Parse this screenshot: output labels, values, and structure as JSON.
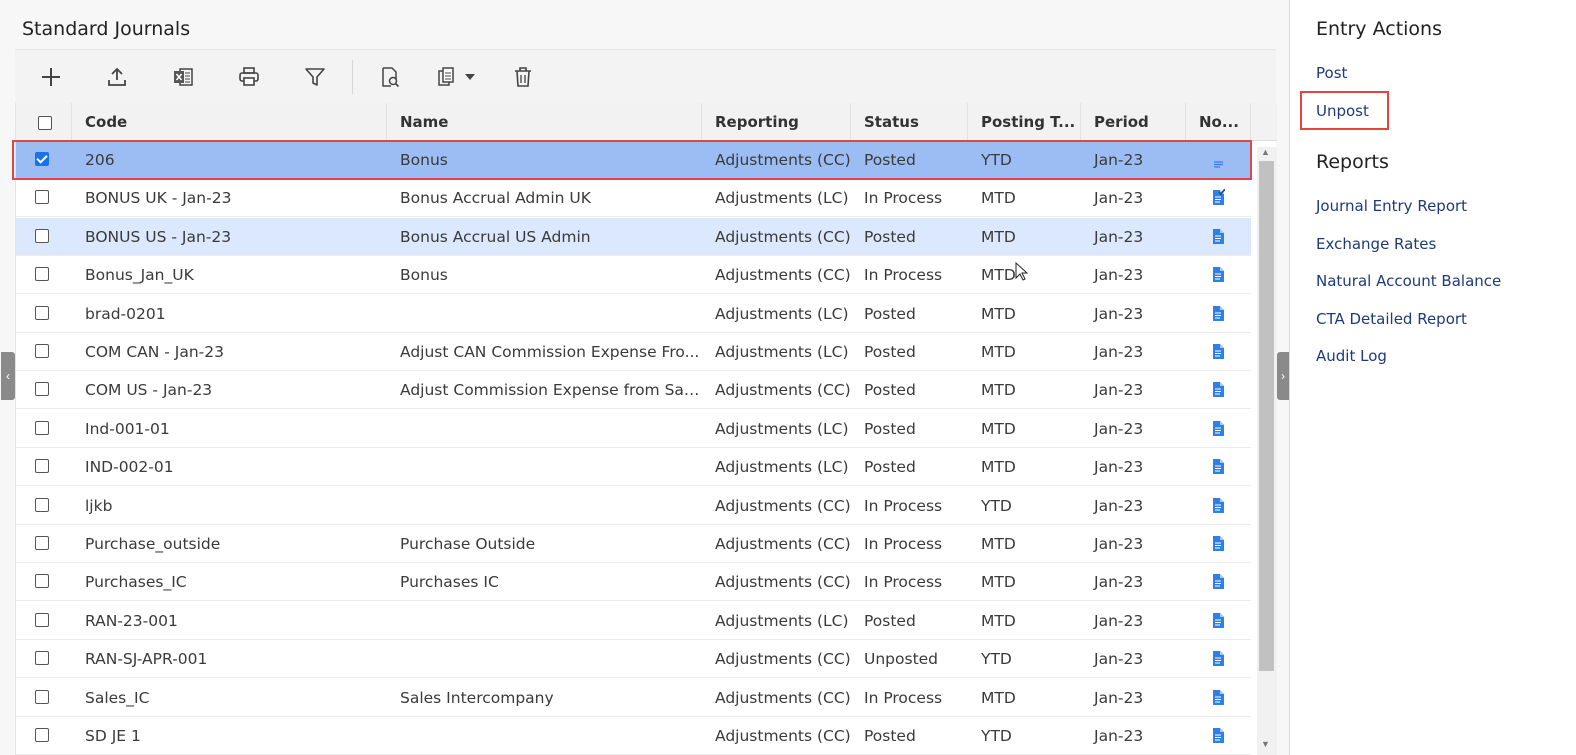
{
  "page": {
    "title": "Standard Journals"
  },
  "toolbar": {
    "buttons": [
      {
        "icon": "plus-icon"
      },
      {
        "icon": "upload-icon"
      },
      {
        "icon": "excel-icon"
      },
      {
        "icon": "print-icon"
      },
      {
        "icon": "filter-icon"
      },
      {
        "icon": "view-document-icon"
      },
      {
        "icon": "copy-dropdown-icon"
      },
      {
        "icon": "trash-icon"
      }
    ]
  },
  "grid": {
    "columns": [
      "Code",
      "Name",
      "Reporting",
      "Status",
      "Posting T...",
      "Period",
      "No..."
    ],
    "rows": [
      {
        "code": "206",
        "name": "Bonus",
        "reporting": "Adjustments (CC)",
        "status": "Posted",
        "posting_type": "YTD",
        "period": "Jan-23",
        "checked": true,
        "note": "lines"
      },
      {
        "code": "BONUS UK - Jan-23",
        "name": "Bonus Accrual Admin UK",
        "reporting": "Adjustments (LC)",
        "status": "In Process",
        "posting_type": "MTD",
        "period": "Jan-23",
        "checked": false,
        "note": "doc-check"
      },
      {
        "code": "BONUS US - Jan-23",
        "name": "Bonus Accrual US Admin",
        "reporting": "Adjustments (CC)",
        "status": "Posted",
        "posting_type": "MTD",
        "period": "Jan-23",
        "checked": false,
        "note": "doc"
      },
      {
        "code": "Bonus_Jan_UK",
        "name": "Bonus",
        "reporting": "Adjustments (CC)",
        "status": "In Process",
        "posting_type": "MTD",
        "period": "Jan-23",
        "checked": false,
        "note": "doc"
      },
      {
        "code": "brad-0201",
        "name": "",
        "reporting": "Adjustments (LC)",
        "status": "Posted",
        "posting_type": "MTD",
        "period": "Jan-23",
        "checked": false,
        "note": "doc"
      },
      {
        "code": "COM CAN - Jan-23",
        "name": "Adjust CAN Commission Expense Fro...",
        "reporting": "Adjustments (LC)",
        "status": "Posted",
        "posting_type": "MTD",
        "period": "Jan-23",
        "checked": false,
        "note": "doc"
      },
      {
        "code": "COM US - Jan-23",
        "name": "Adjust Commission Expense from Sale...",
        "reporting": "Adjustments (CC)",
        "status": "Posted",
        "posting_type": "MTD",
        "period": "Jan-23",
        "checked": false,
        "note": "doc"
      },
      {
        "code": "Ind-001-01",
        "name": "",
        "reporting": "Adjustments (LC)",
        "status": "Posted",
        "posting_type": "MTD",
        "period": "Jan-23",
        "checked": false,
        "note": "doc"
      },
      {
        "code": "IND-002-01",
        "name": "",
        "reporting": "Adjustments (LC)",
        "status": "Posted",
        "posting_type": "MTD",
        "period": "Jan-23",
        "checked": false,
        "note": "doc"
      },
      {
        "code": "ljkb",
        "name": "",
        "reporting": "Adjustments (CC)",
        "status": "In Process",
        "posting_type": "YTD",
        "period": "Jan-23",
        "checked": false,
        "note": "doc"
      },
      {
        "code": "Purchase_outside",
        "name": "Purchase Outside",
        "reporting": "Adjustments (CC)",
        "status": "In Process",
        "posting_type": "MTD",
        "period": "Jan-23",
        "checked": false,
        "note": "doc"
      },
      {
        "code": "Purchases_IC",
        "name": "Purchases IC",
        "reporting": "Adjustments (CC)",
        "status": "In Process",
        "posting_type": "MTD",
        "period": "Jan-23",
        "checked": false,
        "note": "doc"
      },
      {
        "code": "RAN-23-001",
        "name": "",
        "reporting": "Adjustments (LC)",
        "status": "Posted",
        "posting_type": "MTD",
        "period": "Jan-23",
        "checked": false,
        "note": "doc"
      },
      {
        "code": "RAN-SJ-APR-001",
        "name": "",
        "reporting": "Adjustments (CC)",
        "status": "Unposted",
        "posting_type": "YTD",
        "period": "Jan-23",
        "checked": false,
        "note": "doc"
      },
      {
        "code": "Sales_IC",
        "name": "Sales Intercompany",
        "reporting": "Adjustments (CC)",
        "status": "In Process",
        "posting_type": "MTD",
        "period": "Jan-23",
        "checked": false,
        "note": "doc"
      },
      {
        "code": "SD JE 1",
        "name": "",
        "reporting": "Adjustments (CC)",
        "status": "Posted",
        "posting_type": "YTD",
        "period": "Jan-23",
        "checked": false,
        "note": "doc"
      }
    ]
  },
  "sidebar": {
    "entry_actions_title": "Entry Actions",
    "entry_actions": [
      "Post",
      "Unpost"
    ],
    "reports_title": "Reports",
    "reports": [
      "Journal Entry Report",
      "Exchange Rates",
      "Natural Account Balance",
      "CTA Detailed Report",
      "Audit Log"
    ]
  },
  "colors": {
    "selected_row": "#9bbdf3",
    "hover_row": "#dbe8fd",
    "highlight_border": "#e04646",
    "link": "#1e3a7a",
    "note_icon": "#2f7fe6"
  }
}
